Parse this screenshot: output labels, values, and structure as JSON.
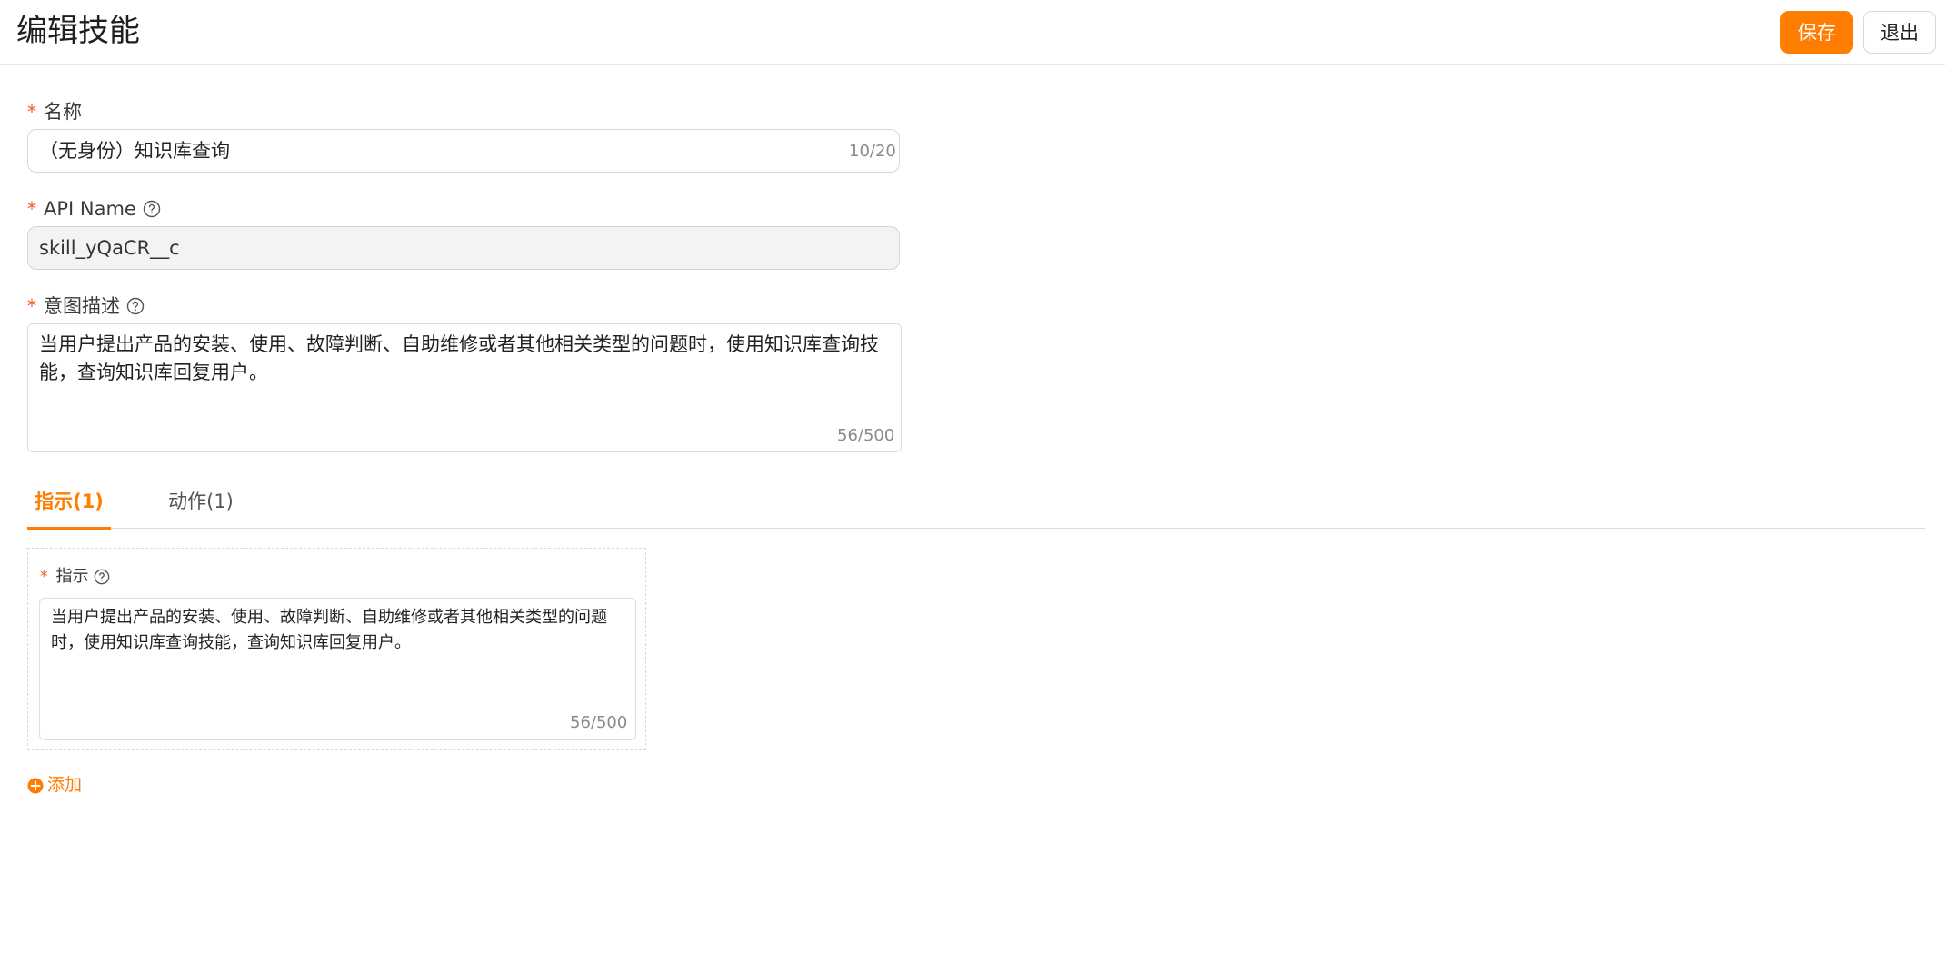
{
  "header": {
    "title": "编辑技能",
    "save_label": "保存",
    "exit_label": "退出"
  },
  "form": {
    "name": {
      "label": "名称",
      "required": "*",
      "value": "（无身份）知识库查询",
      "counter": "10/20"
    },
    "api_name": {
      "label": "API Name",
      "required": "*",
      "value": "skill_yQaCR__c"
    },
    "intent": {
      "label": "意图描述",
      "required": "*",
      "value": "当用户提出产品的安装、使用、故障判断、自助维修或者其他相关类型的问题时，使用知识库查询技能，查询知识库回复用户。",
      "counter": "56/500"
    }
  },
  "tabs": [
    {
      "label": "指示(1)",
      "active": true
    },
    {
      "label": "动作(1)",
      "active": false
    }
  ],
  "instruction": {
    "label": "指示",
    "required": "*",
    "value": "当用户提出产品的安装、使用、故障判断、自助维修或者其他相关类型的问题时，使用知识库查询技能，查询知识库回复用户。",
    "counter": "56/500"
  },
  "add_label": "添加",
  "icons": {
    "help": "help-circle-icon",
    "add": "plus-circle-icon"
  },
  "colors": {
    "accent": "#ff7d00",
    "required": "#f5561e",
    "border": "#d6d6d6",
    "disabled_bg": "#f2f3f5"
  }
}
